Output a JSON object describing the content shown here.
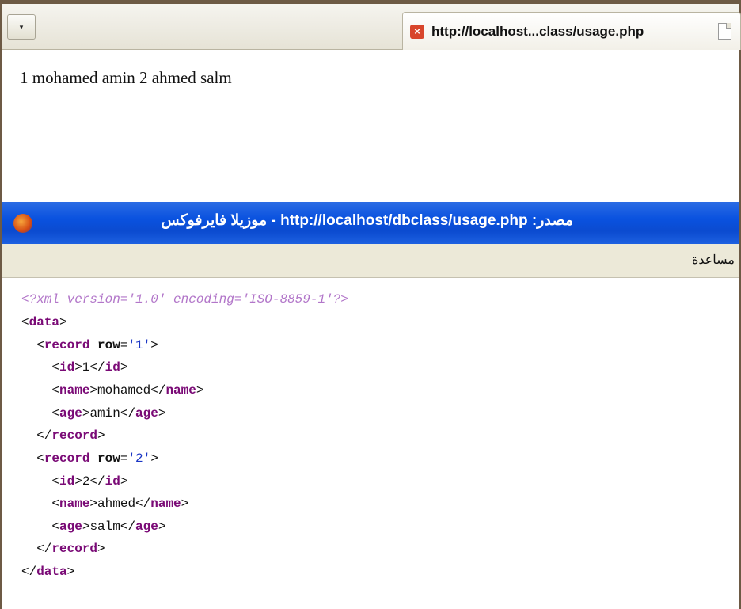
{
  "tabbar": {
    "dropdown_glyph": "▾",
    "tab_title": "http://localhost...class/usage.php",
    "close_glyph": "×"
  },
  "page": {
    "text": "1 mohamed amin 2 ahmed salm"
  },
  "source_window": {
    "title": "موزيلا فايرفوكس - http://localhost/dbclass/usage.php :مصدر"
  },
  "menu": {
    "help": "مساعدة"
  },
  "xml": {
    "declaration": "<?xml version='1.0' encoding='ISO-8859-1'?>",
    "data_tag": "data",
    "record_tag": "record",
    "row_attr": "row",
    "id_tag": "id",
    "name_tag": "name",
    "age_tag": "age",
    "records": [
      {
        "row": "'1'",
        "id": "1",
        "name": "mohamed",
        "age": "amin"
      },
      {
        "row": "'2'",
        "id": "2",
        "name": "ahmed",
        "age": "salm"
      }
    ]
  },
  "colors": {
    "titlebar": "#0b4bd0",
    "tag": "#7a0a76",
    "attr_value": "#1a36c5",
    "processing_instruction": "#b276c9"
  }
}
